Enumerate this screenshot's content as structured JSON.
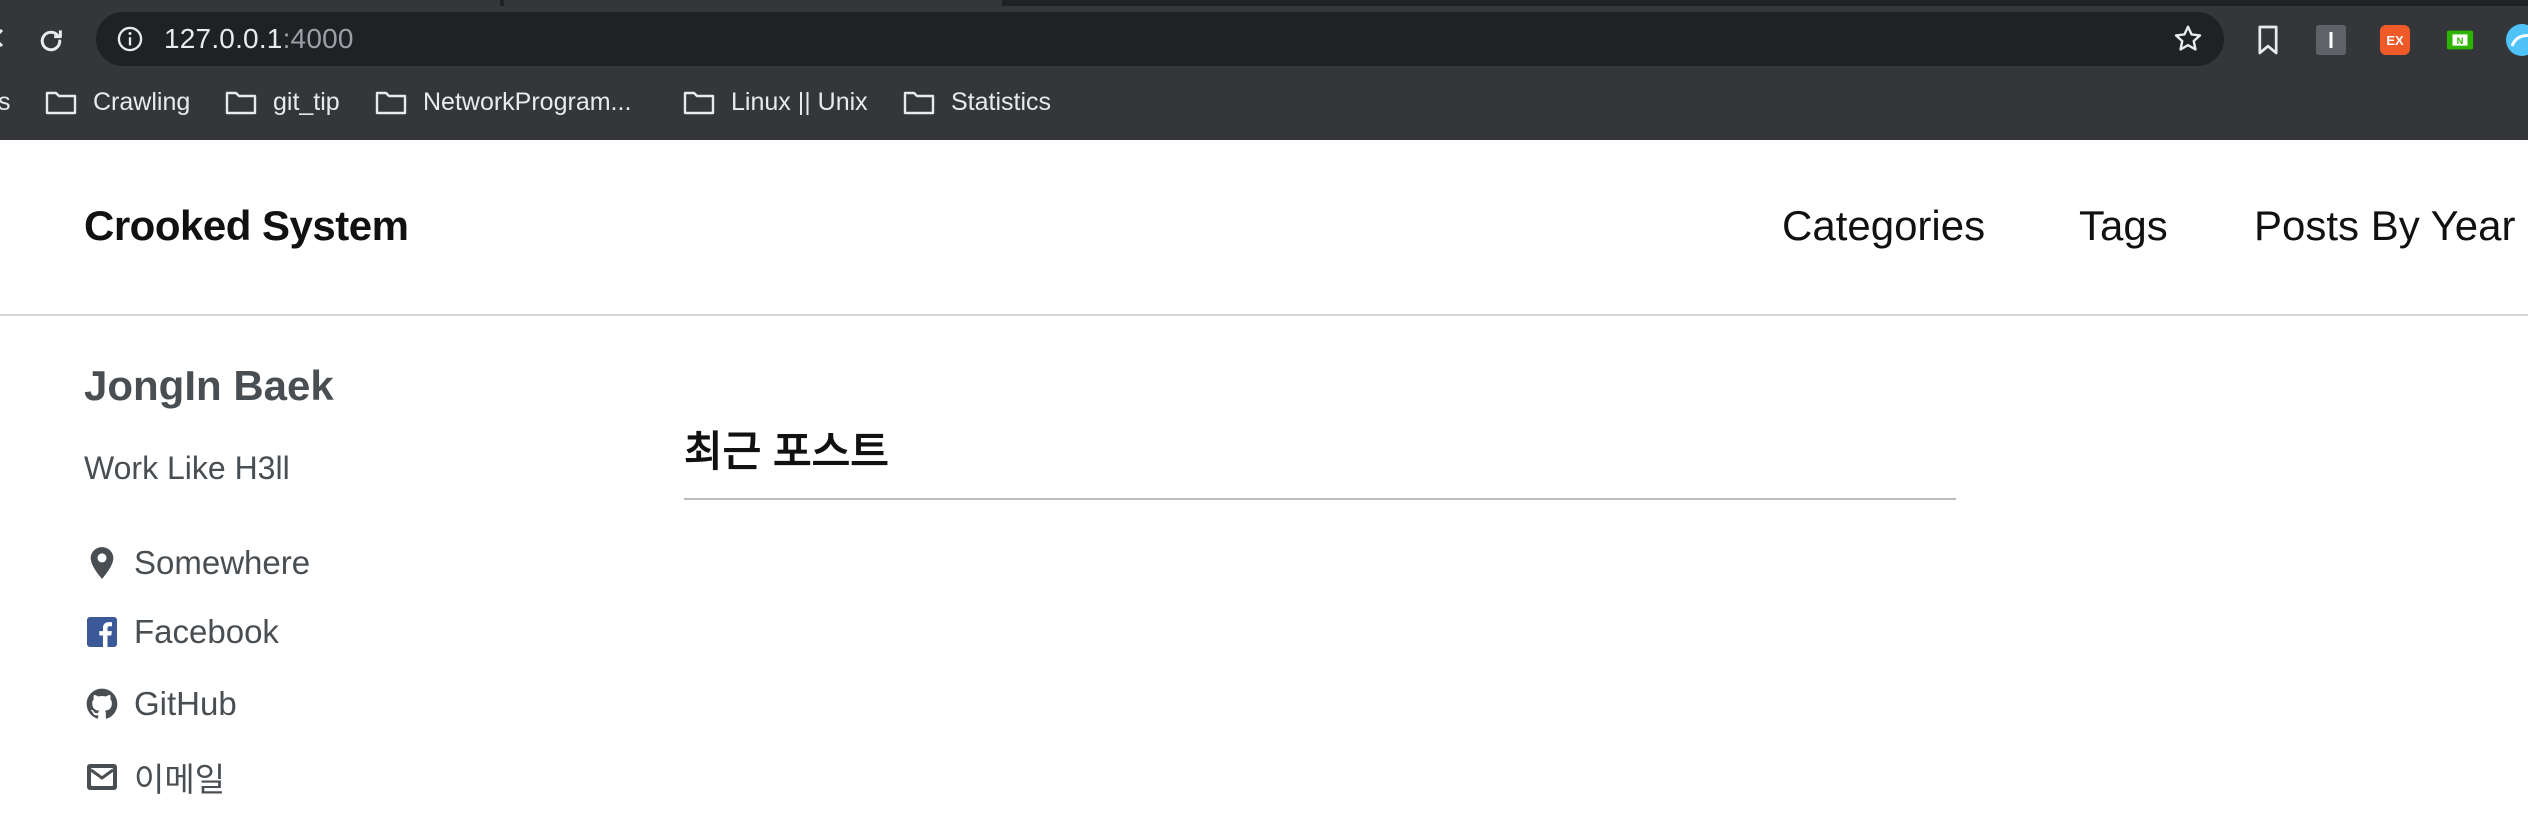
{
  "browser": {
    "url_host": "127.0.0.1",
    "url_port": ":4000",
    "bookmarks": [
      {
        "label": "s"
      },
      {
        "label": "Crawling"
      },
      {
        "label": "git_tip"
      },
      {
        "label": "NetworkProgram..."
      },
      {
        "label": "Linux || Unix"
      },
      {
        "label": "Statistics"
      }
    ],
    "extensions": [
      {
        "name": "extension-i-icon",
        "text": "I",
        "color": "#5f6368"
      },
      {
        "name": "extension-ex-icon",
        "text": "EX",
        "color": "#f05a28"
      },
      {
        "name": "extension-n-icon",
        "text": "N",
        "color": "#2db400"
      }
    ]
  },
  "site": {
    "title": "Crooked System",
    "nav": [
      {
        "label": "Categories"
      },
      {
        "label": "Tags"
      },
      {
        "label": "Posts By Year"
      }
    ]
  },
  "author": {
    "name": "JongIn Baek",
    "bio": "Work Like H3ll",
    "links": [
      {
        "label": "Somewhere",
        "icon": "map-marker-icon"
      },
      {
        "label": "Facebook",
        "icon": "facebook-icon"
      },
      {
        "label": "GitHub",
        "icon": "github-icon"
      },
      {
        "label": "이메일",
        "icon": "email-icon"
      }
    ]
  },
  "main": {
    "heading": "최근 포스트"
  },
  "colors": {
    "chrome_bg": "#35363a",
    "omnibox_bg": "#202124",
    "text_dark": "#111111",
    "text_muted": "#494e52",
    "facebook_blue": "#3b5998"
  }
}
